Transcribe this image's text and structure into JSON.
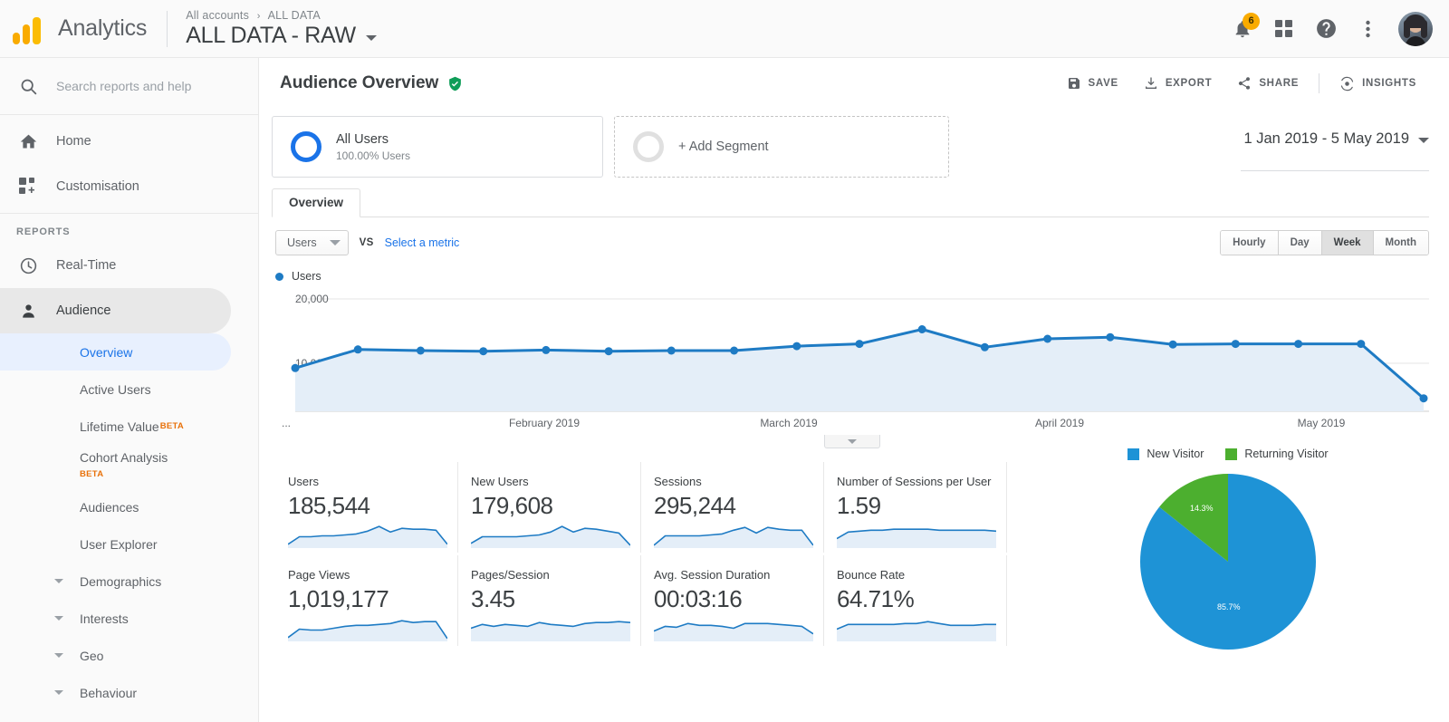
{
  "topbar": {
    "brand": "Analytics",
    "breadcrumb_root": "All accounts",
    "breadcrumb_sep": "›",
    "breadcrumb_leaf": "ALL DATA",
    "property_name": "ALL DATA - RAW",
    "notification_count": "6"
  },
  "sidebar": {
    "search_placeholder": "Search reports and help",
    "search_value": "",
    "home_label": "Home",
    "customisation_label": "Customisation",
    "reports_label": "REPORTS",
    "realtime_label": "Real-Time",
    "audience_label": "Audience",
    "sub_items": [
      {
        "label": "Overview",
        "selected": true
      },
      {
        "label": "Active Users",
        "selected": false
      },
      {
        "label": "Lifetime Value",
        "badge": "BETA",
        "selected": false
      },
      {
        "label": "Cohort Analysis",
        "badge": "BETA",
        "selected": false
      },
      {
        "label": "Audiences",
        "selected": false
      },
      {
        "label": "User Explorer",
        "selected": false
      },
      {
        "label": "Demographics",
        "expandable": true
      },
      {
        "label": "Interests",
        "expandable": true
      },
      {
        "label": "Geo",
        "expandable": true
      },
      {
        "label": "Behaviour",
        "expandable": true
      }
    ]
  },
  "page": {
    "title": "Audience Overview",
    "actions": {
      "save": "SAVE",
      "export": "EXPORT",
      "share": "SHARE",
      "insights": "INSIGHTS"
    },
    "date_range": "1 Jan 2019 - 5 May 2019",
    "tab_overview": "Overview"
  },
  "segments": {
    "all_users_title": "All Users",
    "all_users_sub": "100.00% Users",
    "add_segment_label": "+ Add Segment"
  },
  "chart_controls": {
    "metric_selected": "Users",
    "vs_label": "VS",
    "select_metric": "Select a metric",
    "granularity": [
      {
        "label": "Hourly",
        "selected": false
      },
      {
        "label": "Day",
        "selected": false
      },
      {
        "label": "Week",
        "selected": true
      },
      {
        "label": "Month",
        "selected": false
      }
    ],
    "legend_label": "Users"
  },
  "metric_cards": [
    {
      "label": "Users",
      "value": "185,544"
    },
    {
      "label": "New Users",
      "value": "179,608"
    },
    {
      "label": "Sessions",
      "value": "295,244"
    },
    {
      "label": "Number of Sessions per User",
      "value": "1.59"
    },
    {
      "label": "Page Views",
      "value": "1,019,177"
    },
    {
      "label": "Pages/Session",
      "value": "3.45"
    },
    {
      "label": "Avg. Session Duration",
      "value": "00:03:16"
    },
    {
      "label": "Bounce Rate",
      "value": "64.71%"
    }
  ],
  "colors": {
    "line_blue": "#1e7bc4",
    "area_blue": "#e4eef8",
    "pie_blue": "#1e93d6",
    "pie_green": "#4caf2f",
    "link_blue": "#1a73e8",
    "badge_amber": "#f9ab00",
    "beta_orange": "#e8710a"
  },
  "chart_data": [
    {
      "type": "line",
      "title": "Users",
      "ylabel": "Users",
      "xlabel": "",
      "ylim": [
        0,
        20000
      ],
      "yticks": [
        10000,
        20000
      ],
      "ytick_labels": [
        "10,000",
        "20,000"
      ],
      "grid": true,
      "legend": [
        "Users"
      ],
      "legend_position": "top-left",
      "x_tick_labels": [
        "...",
        "February 2019",
        "March 2019",
        "April 2019",
        "May 2019"
      ],
      "x": [
        1,
        2,
        3,
        4,
        5,
        6,
        7,
        8,
        9,
        10,
        11,
        12,
        13,
        14,
        15,
        16,
        17,
        18,
        19
      ],
      "values": [
        7700,
        11000,
        10800,
        10700,
        10900,
        10700,
        10800,
        10800,
        11600,
        12000,
        14600,
        11400,
        12900,
        13200,
        11900,
        12000,
        12000,
        12000,
        2300
      ]
    },
    {
      "type": "pie",
      "title": "",
      "labels": [
        "New Visitor",
        "Returning Visitor"
      ],
      "values": [
        85.7,
        14.3
      ],
      "value_labels": [
        "85.7%",
        "14.3%"
      ],
      "colors": [
        "#1e93d6",
        "#4caf2f"
      ],
      "legend_position": "top"
    },
    {
      "type": "line",
      "title": "Users sparkline",
      "values": [
        4,
        12,
        12,
        13,
        13,
        14,
        15,
        18,
        23,
        17,
        21,
        20,
        20,
        19,
        4
      ]
    },
    {
      "type": "line",
      "title": "New Users sparkline",
      "values": [
        5,
        12,
        12,
        12,
        12,
        13,
        14,
        17,
        23,
        17,
        21,
        20,
        18,
        16,
        3
      ]
    },
    {
      "type": "line",
      "title": "Sessions sparkline",
      "values": [
        3,
        13,
        13,
        13,
        13,
        14,
        15,
        19,
        22,
        16,
        22,
        20,
        19,
        19,
        3
      ]
    },
    {
      "type": "line",
      "title": "Sessions per User sparkline",
      "values": [
        10,
        17,
        18,
        19,
        19,
        20,
        20,
        20,
        20,
        19,
        19,
        19,
        19,
        19,
        18
      ]
    },
    {
      "type": "line",
      "title": "Page Views sparkline",
      "values": [
        4,
        13,
        12,
        12,
        14,
        16,
        17,
        17,
        18,
        19,
        22,
        20,
        21,
        21,
        3
      ]
    },
    {
      "type": "line",
      "title": "Pages/Session sparkline",
      "values": [
        14,
        18,
        16,
        18,
        17,
        16,
        20,
        18,
        17,
        16,
        19,
        20,
        20,
        21,
        20
      ]
    },
    {
      "type": "line",
      "title": "Avg. Session Duration sparkline",
      "values": [
        11,
        16,
        15,
        19,
        17,
        17,
        16,
        14,
        19,
        19,
        19,
        18,
        17,
        16,
        8
      ]
    },
    {
      "type": "line",
      "title": "Bounce Rate sparkline",
      "values": [
        13,
        18,
        18,
        18,
        18,
        18,
        19,
        19,
        21,
        19,
        17,
        17,
        17,
        18,
        18
      ]
    }
  ]
}
